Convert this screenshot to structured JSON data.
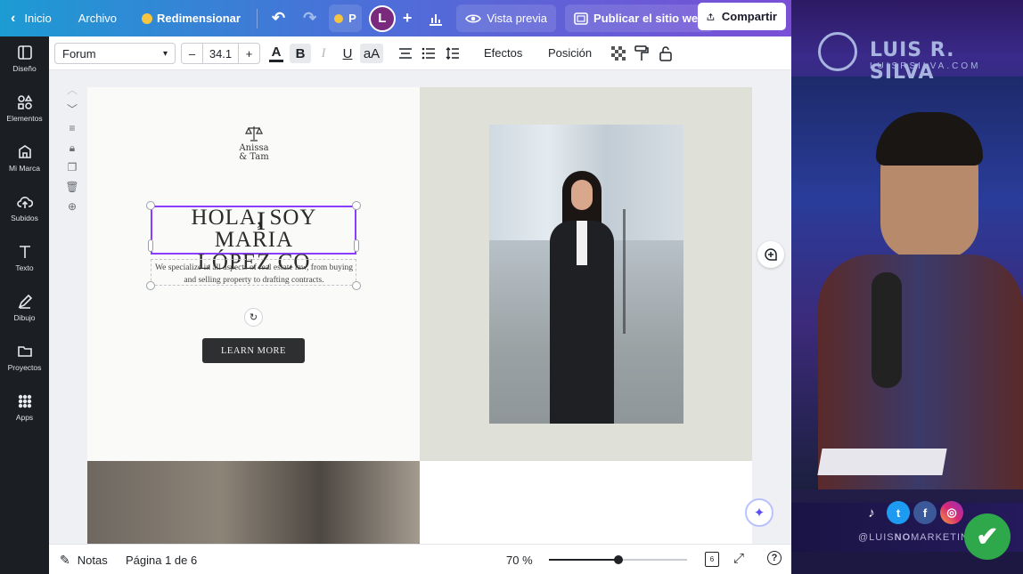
{
  "topbar": {
    "back_label": "Inicio",
    "file_label": "Archivo",
    "resize_label": "Redimensionar",
    "truncated_label": "P",
    "avatar_letter": "L",
    "preview_label": "Vista previa",
    "publish_label": "Publicar el sitio web",
    "share_label": "Compartir"
  },
  "sidebar": {
    "items": [
      {
        "label": "Diseño",
        "icon": "layout-icon"
      },
      {
        "label": "Elementos",
        "icon": "shapes-icon"
      },
      {
        "label": "Mi Marca",
        "icon": "brand-icon"
      },
      {
        "label": "Subidos",
        "icon": "cloud-upload-icon"
      },
      {
        "label": "Texto",
        "icon": "text-icon"
      },
      {
        "label": "Dibujo",
        "icon": "pen-icon"
      },
      {
        "label": "Proyectos",
        "icon": "folder-icon"
      },
      {
        "label": "Apps",
        "icon": "grid-icon"
      }
    ]
  },
  "toolbar": {
    "font_name": "Forum",
    "font_size": "34.1",
    "minus": "–",
    "plus": "+",
    "effects_label": "Efectos",
    "position_label": "Posición",
    "text_color": "#1f2328"
  },
  "canvas": {
    "logo_name_1": "Anissa",
    "logo_name_2": "& Tam",
    "heading_line_1": "HOLA, SOY MARIA",
    "heading_line_2": "LÓPEZ CO",
    "paragraph": "We specialize in all aspects of real estate law, from buying and selling property to drafting contracts.",
    "button_label": "LEARN MORE"
  },
  "footer": {
    "notes_label": "Notas",
    "page_label": "Página 1 de 6",
    "zoom_label": "70 %",
    "zoom_level": 0.5,
    "pages_count": "6"
  },
  "overlay": {
    "brand_name": "LUIS R. SILVA",
    "brand_url": "LUISRSILVA.COM",
    "social_handle_prefix": "@LUIS",
    "social_handle_bold": "NO",
    "social_handle_suffix": "MARKETING"
  },
  "colors": {
    "accent": "#8b3dff",
    "topbar_start": "#1d9bd3",
    "topbar_end": "#7a4fd6",
    "sidebar": "#1b1f24"
  }
}
